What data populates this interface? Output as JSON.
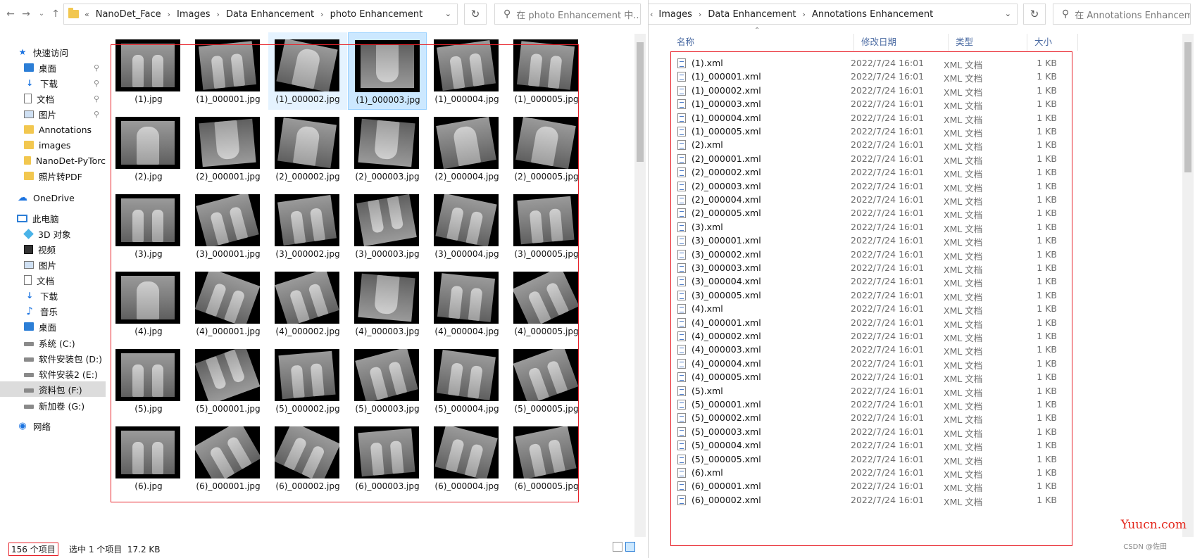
{
  "left": {
    "path": [
      "NanoDet_Face",
      "Images",
      "Data Enhancement",
      "photo Enhancement"
    ],
    "overflow_chevron": "«",
    "search_placeholder": "在 photo Enhancement 中...",
    "nav": [
      {
        "label": "快速访问",
        "icon": "star-icon",
        "pinned": false
      },
      {
        "label": "桌面",
        "icon": "desktop-icon",
        "pinned": true
      },
      {
        "label": "下载",
        "icon": "download-icon",
        "pinned": true
      },
      {
        "label": "文档",
        "icon": "document-icon",
        "pinned": true
      },
      {
        "label": "图片",
        "icon": "picture-icon",
        "pinned": true
      },
      {
        "label": "Annotations",
        "icon": "folder-icon",
        "pinned": false
      },
      {
        "label": "images",
        "icon": "folder-icon",
        "pinned": false
      },
      {
        "label": "NanoDet-PyTorc",
        "icon": "folder-icon",
        "pinned": false
      },
      {
        "label": "照片转PDF",
        "icon": "folder-icon",
        "pinned": false
      },
      {
        "label": "OneDrive",
        "icon": "cloud-icon",
        "pinned": false
      },
      {
        "label": "此电脑",
        "icon": "computer-icon",
        "pinned": false
      },
      {
        "label": "3D 对象",
        "icon": "3d-objects-icon",
        "pinned": false
      },
      {
        "label": "视频",
        "icon": "video-icon",
        "pinned": false
      },
      {
        "label": "图片",
        "icon": "picture-icon",
        "pinned": false
      },
      {
        "label": "文档",
        "icon": "document-icon",
        "pinned": false
      },
      {
        "label": "下载",
        "icon": "download-icon",
        "pinned": false
      },
      {
        "label": "音乐",
        "icon": "music-icon",
        "pinned": false
      },
      {
        "label": "桌面",
        "icon": "desktop-icon",
        "pinned": false
      },
      {
        "label": "系统 (C:)",
        "icon": "drive-icon",
        "pinned": false
      },
      {
        "label": "软件安装包 (D:)",
        "icon": "drive-icon",
        "pinned": false
      },
      {
        "label": "软件安装2 (E:)",
        "icon": "drive-icon",
        "pinned": false
      },
      {
        "label": "资料包 (F:)",
        "icon": "drive-icon",
        "pinned": false,
        "selected": true
      },
      {
        "label": "新加卷 (G:)",
        "icon": "drive-icon",
        "pinned": false
      },
      {
        "label": "网络",
        "icon": "network-icon",
        "pinned": false
      }
    ],
    "thumbs": [
      "(1).jpg",
      "(1)_000001.jpg",
      "(1)_000002.jpg",
      "(1)_000003.jpg",
      "(1)_000004.jpg",
      "(1)_000005.jpg",
      "(2).jpg",
      "(2)_000001.jpg",
      "(2)_000002.jpg",
      "(2)_000003.jpg",
      "(2)_000004.jpg",
      "(2)_000005.jpg",
      "(3).jpg",
      "(3)_000001.jpg",
      "(3)_000002.jpg",
      "(3)_000003.jpg",
      "(3)_000004.jpg",
      "(3)_000005.jpg",
      "(4).jpg",
      "(4)_000001.jpg",
      "(4)_000002.jpg",
      "(4)_000003.jpg",
      "(4)_000004.jpg",
      "(4)_000005.jpg",
      "(5).jpg",
      "(5)_000001.jpg",
      "(5)_000002.jpg",
      "(5)_000003.jpg",
      "(5)_000004.jpg",
      "(5)_000005.jpg",
      "(6).jpg",
      "(6)_000001.jpg",
      "(6)_000002.jpg",
      "(6)_000003.jpg",
      "(6)_000004.jpg",
      "(6)_000005.jpg"
    ],
    "selected_thumb": "(1)_000003.jpg",
    "status": {
      "count": "156 个项目",
      "selection": "选中 1 个项目  17.2 KB"
    }
  },
  "right": {
    "path": [
      "Images",
      "Data Enhancement",
      "Annotations Enhancement"
    ],
    "search_placeholder": "在 Annotations Enhancem...",
    "columns": {
      "name": "名称",
      "date": "修改日期",
      "type": "类型",
      "size": "大小"
    },
    "files": [
      "(1).xml",
      "(1)_000001.xml",
      "(1)_000002.xml",
      "(1)_000003.xml",
      "(1)_000004.xml",
      "(1)_000005.xml",
      "(2).xml",
      "(2)_000001.xml",
      "(2)_000002.xml",
      "(2)_000003.xml",
      "(2)_000004.xml",
      "(2)_000005.xml",
      "(3).xml",
      "(3)_000001.xml",
      "(3)_000002.xml",
      "(3)_000003.xml",
      "(3)_000004.xml",
      "(3)_000005.xml",
      "(4).xml",
      "(4)_000001.xml",
      "(4)_000002.xml",
      "(4)_000003.xml",
      "(4)_000004.xml",
      "(4)_000005.xml",
      "(5).xml",
      "(5)_000001.xml",
      "(5)_000002.xml",
      "(5)_000003.xml",
      "(5)_000004.xml",
      "(5)_000005.xml",
      "(6).xml",
      "(6)_000001.xml",
      "(6)_000002.xml"
    ],
    "file_date": "2022/7/24 16:01",
    "file_type": "XML 文档",
    "file_size": "1 KB"
  },
  "watermark": "Yuucn.com",
  "csdn_mark": "CSDN @佐田"
}
